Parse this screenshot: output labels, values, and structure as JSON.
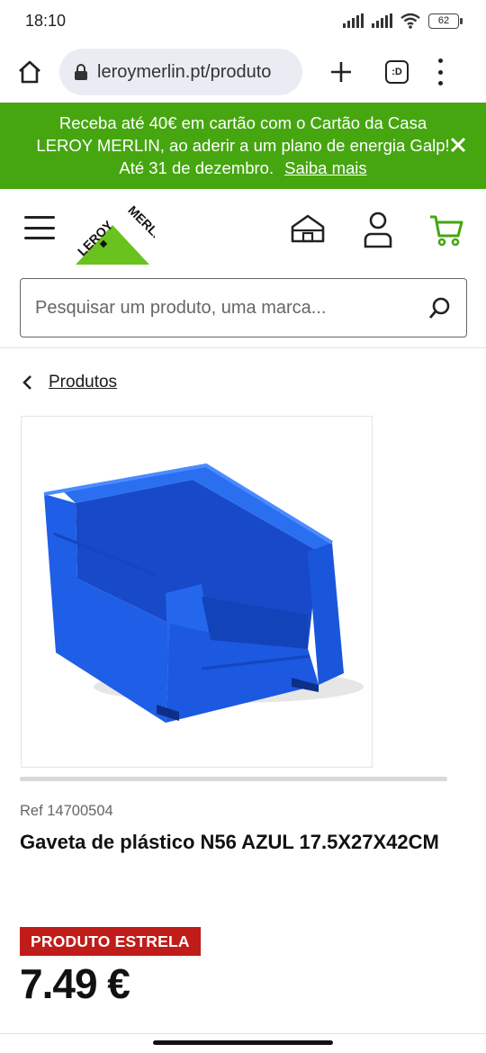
{
  "status_bar": {
    "time": "18:10",
    "battery": "62",
    "icons": [
      "signal-icon",
      "signal-icon",
      "wifi-icon",
      "battery-icon"
    ]
  },
  "browser": {
    "url": "leroymerlin.pt/produto",
    "tabs_label": ":D",
    "icons": [
      "home-icon",
      "lock-icon",
      "plus-icon",
      "tabs-icon",
      "more-icon"
    ]
  },
  "promo": {
    "line1": "Receba até 40€ em cartão com o Cartão da Casa",
    "line2": "LEROY MERLIN, ao aderir a um plano de energia Galp!",
    "line3": "Até 31 de dezembro.",
    "link": "Saiba mais",
    "background": "#46a610"
  },
  "header": {
    "logo_text": "LEROY MERLIN",
    "icons": [
      "menu-icon",
      "store-icon",
      "account-icon",
      "cart-icon"
    ],
    "accent": "#46a610"
  },
  "search": {
    "placeholder": "Pesquisar um produto, uma marca..."
  },
  "breadcrumb": {
    "label": "Produtos"
  },
  "product": {
    "ref": "Ref 14700504",
    "title": "Gaveta de plástico N56 AZUL 17.5X27X42CM",
    "badge": "PRODUTO ESTRELA",
    "badge_color": "#c01c19",
    "price": "7.49 €",
    "image_color": "#1f5ee6"
  }
}
